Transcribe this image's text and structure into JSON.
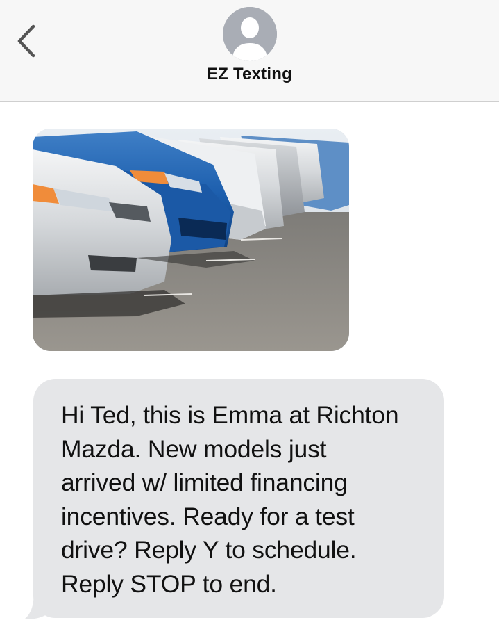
{
  "header": {
    "back_icon": "chevron-left-icon",
    "avatar_icon": "person-silhouette-icon",
    "contact_name": "EZ Texting"
  },
  "thread": {
    "messages": [
      {
        "type": "image",
        "icon": "photo-cars-in-lot"
      },
      {
        "type": "text",
        "lines": [
          "Hi Ted, this is Emma at Richton",
          "Mazda. New models just",
          "arrived w/ limited financing",
          "incentives. Ready for a test",
          "drive? Reply Y to schedule.",
          "Reply STOP to end."
        ]
      }
    ]
  },
  "colors": {
    "header_bg": "#f7f7f7",
    "avatar_bg": "#a9adb5",
    "bubble_bg": "#e5e6e8",
    "text": "#111111",
    "chevron": "#555555"
  }
}
